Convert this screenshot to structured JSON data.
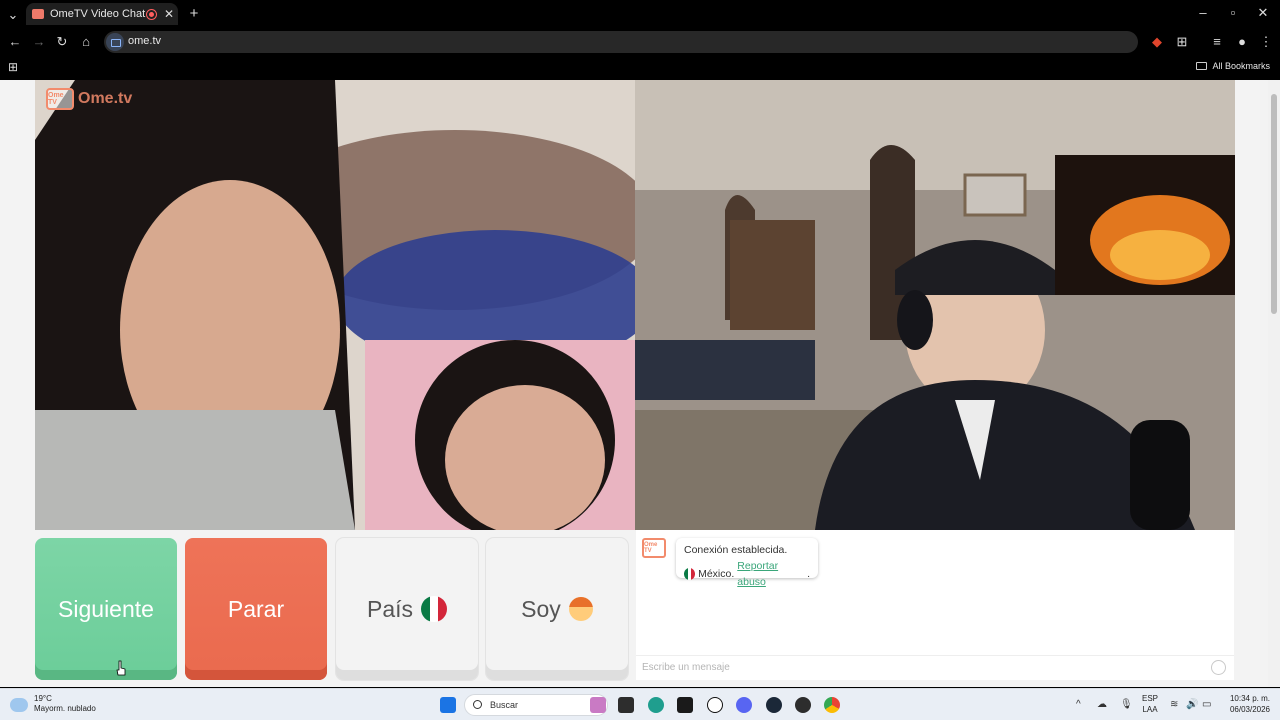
{
  "browser": {
    "tab_title": "OmeTV Video Chat — Ome",
    "url": "ome.tv",
    "bookmarks_label": "All Bookmarks",
    "close_tab_glyph": "✕",
    "new_tab_glyph": "+"
  },
  "site": {
    "logo_text": "Ome.tv",
    "logo_badge": "Ome TV"
  },
  "controls": {
    "next_label": "Siguiente",
    "stop_label": "Parar",
    "country_label": "País",
    "gender_label": "Soy",
    "country_flag": "mexico-flag-icon",
    "gender_icon": "boy-emoji-icon"
  },
  "chat": {
    "status_line": "Conexión establecida.",
    "country": "México.",
    "report_link": "Reportar abuso",
    "report_suffix": ".",
    "input_placeholder": "Escribe un mensaje",
    "avatar_badge": "Ome TV"
  },
  "taskbar": {
    "temperature": "19°C",
    "weather_desc": "Mayorm. nublado",
    "search_placeholder": "Buscar",
    "lang_top": "ESP",
    "lang_bottom": "LAA",
    "time": "10:34 p. m.",
    "date": "06/03/2026"
  },
  "colors": {
    "next_green": "#6bcd99",
    "stop_red": "#ea6a4e",
    "brand_orange": "#f28b6c",
    "link_green": "#3aa67a"
  }
}
